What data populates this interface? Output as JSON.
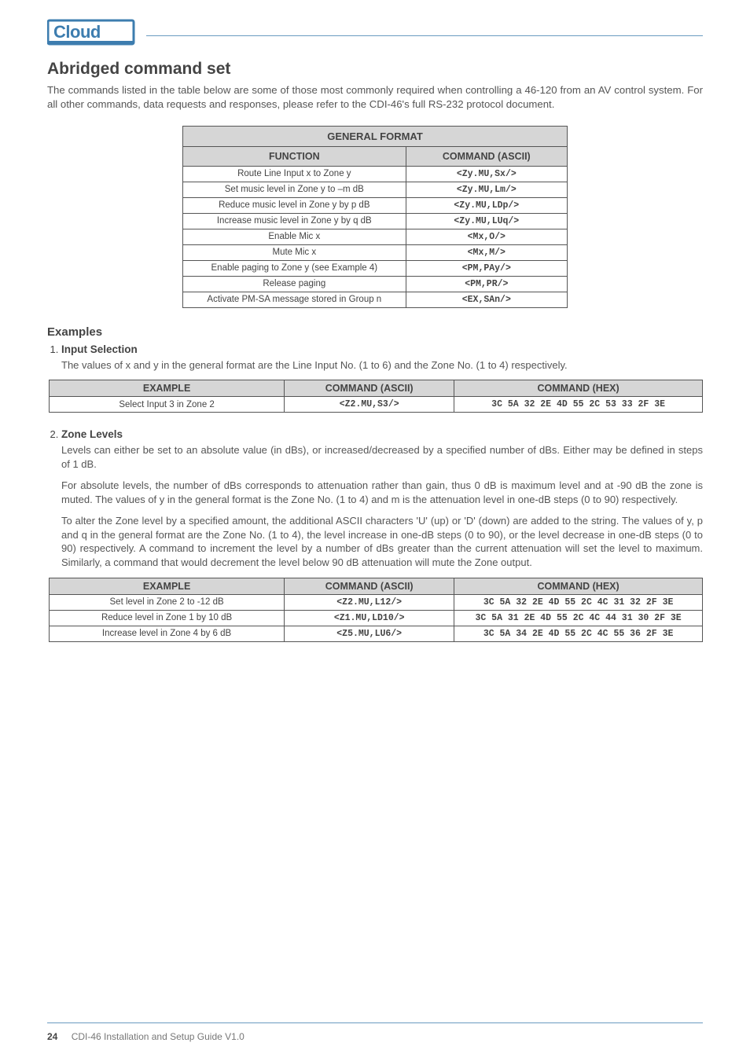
{
  "logo_text": "Cloud",
  "heading": "Abridged command set",
  "intro": "The commands listed in the table below are some of those most commonly required when controlling a 46-120 from an AV control system. For all other commands, data requests and responses, please refer to the CDI-46's full RS-232 protocol document.",
  "general_table": {
    "title": "GENERAL FORMAT",
    "col_function": "FUNCTION",
    "col_command": "COMMAND (ASCII)",
    "rows": [
      {
        "fn": "Route Line Input x to Zone y",
        "cmd": "<Zy.MU,Sx/>"
      },
      {
        "fn": "Set music level in Zone y to –m dB",
        "cmd": "<Zy.MU,Lm/>"
      },
      {
        "fn": "Reduce music level in Zone y by p dB",
        "cmd": "<Zy.MU,LDp/>"
      },
      {
        "fn": "Increase music level in Zone y by q dB",
        "cmd": "<Zy.MU,LUq/>"
      },
      {
        "fn": "Enable Mic x",
        "cmd": "<Mx,O/>"
      },
      {
        "fn": "Mute Mic x",
        "cmd": "<Mx,M/>"
      },
      {
        "fn": "Enable paging to Zone y (see Example 4)",
        "cmd": "<PM,PAy/>"
      },
      {
        "fn": "Release paging",
        "cmd": "<PM,PR/>"
      },
      {
        "fn": "Activate PM-SA message stored in Group n",
        "cmd": "<EX,SAn/>"
      }
    ]
  },
  "examples_heading": "Examples",
  "examples": {
    "input_selection": {
      "title": "Input Selection",
      "text": "The values of x and y in the general format are the Line Input No. (1 to 6) and the Zone No. (1 to 4) respectively.",
      "table": {
        "headers": {
          "example": "EXAMPLE",
          "ascii": "COMMAND (ASCII)",
          "hex": "COMMAND (HEX)"
        },
        "rows": [
          {
            "ex": "Select Input 3 in Zone 2",
            "ascii": "<Z2.MU,S3/>",
            "hex": "3C 5A 32 2E 4D 55 2C 53 33 2F 3E"
          }
        ]
      }
    },
    "zone_levels": {
      "title": "Zone Levels",
      "p1": "Levels can either be set to an absolute value (in dBs), or increased/decreased by a specified number of dBs. Either may be defined in steps of 1 dB.",
      "p2": "For absolute levels, the number of dBs corresponds to attenuation rather than gain, thus 0 dB is maximum level and at -90 dB the zone is muted. The values of y in the general format is the Zone No. (1 to 4) and m is the attenuation level in one-dB steps (0 to 90) respectively.",
      "p3": "To alter the Zone level by a specified amount, the additional ASCII characters 'U' (up) or 'D' (down) are added to the string. The values of y, p and q in the general format are the Zone No. (1 to 4), the level increase in one-dB steps (0 to 90), or the level decrease in one-dB steps (0 to 90) respectively. A command to increment the level by a number of dBs greater than the current attenuation will set the level to maximum. Similarly, a command that would decrement the level below 90 dB attenuation will mute the Zone output.",
      "table": {
        "headers": {
          "example": "EXAMPLE",
          "ascii": "COMMAND (ASCII)",
          "hex": "COMMAND (HEX)"
        },
        "rows": [
          {
            "ex": "Set level in Zone 2 to -12 dB",
            "ascii": "<Z2.MU,L12/>",
            "hex": "3C 5A 32 2E 4D 55 2C 4C 31 32 2F 3E"
          },
          {
            "ex": "Reduce level in Zone 1 by 10 dB",
            "ascii": "<Z1.MU,LD10/>",
            "hex": "3C 5A 31 2E 4D 55 2C 4C 44 31 30 2F 3E"
          },
          {
            "ex": "Increase level in Zone 4 by 6 dB",
            "ascii": "<Z5.MU,LU6/>",
            "hex": "3C 5A 34 2E 4D 55 2C 4C 55 36 2F 3E"
          }
        ]
      }
    }
  },
  "footer": {
    "page_number": "24",
    "doc_title": "CDI-46 Installation and Setup Guide V1.0"
  }
}
